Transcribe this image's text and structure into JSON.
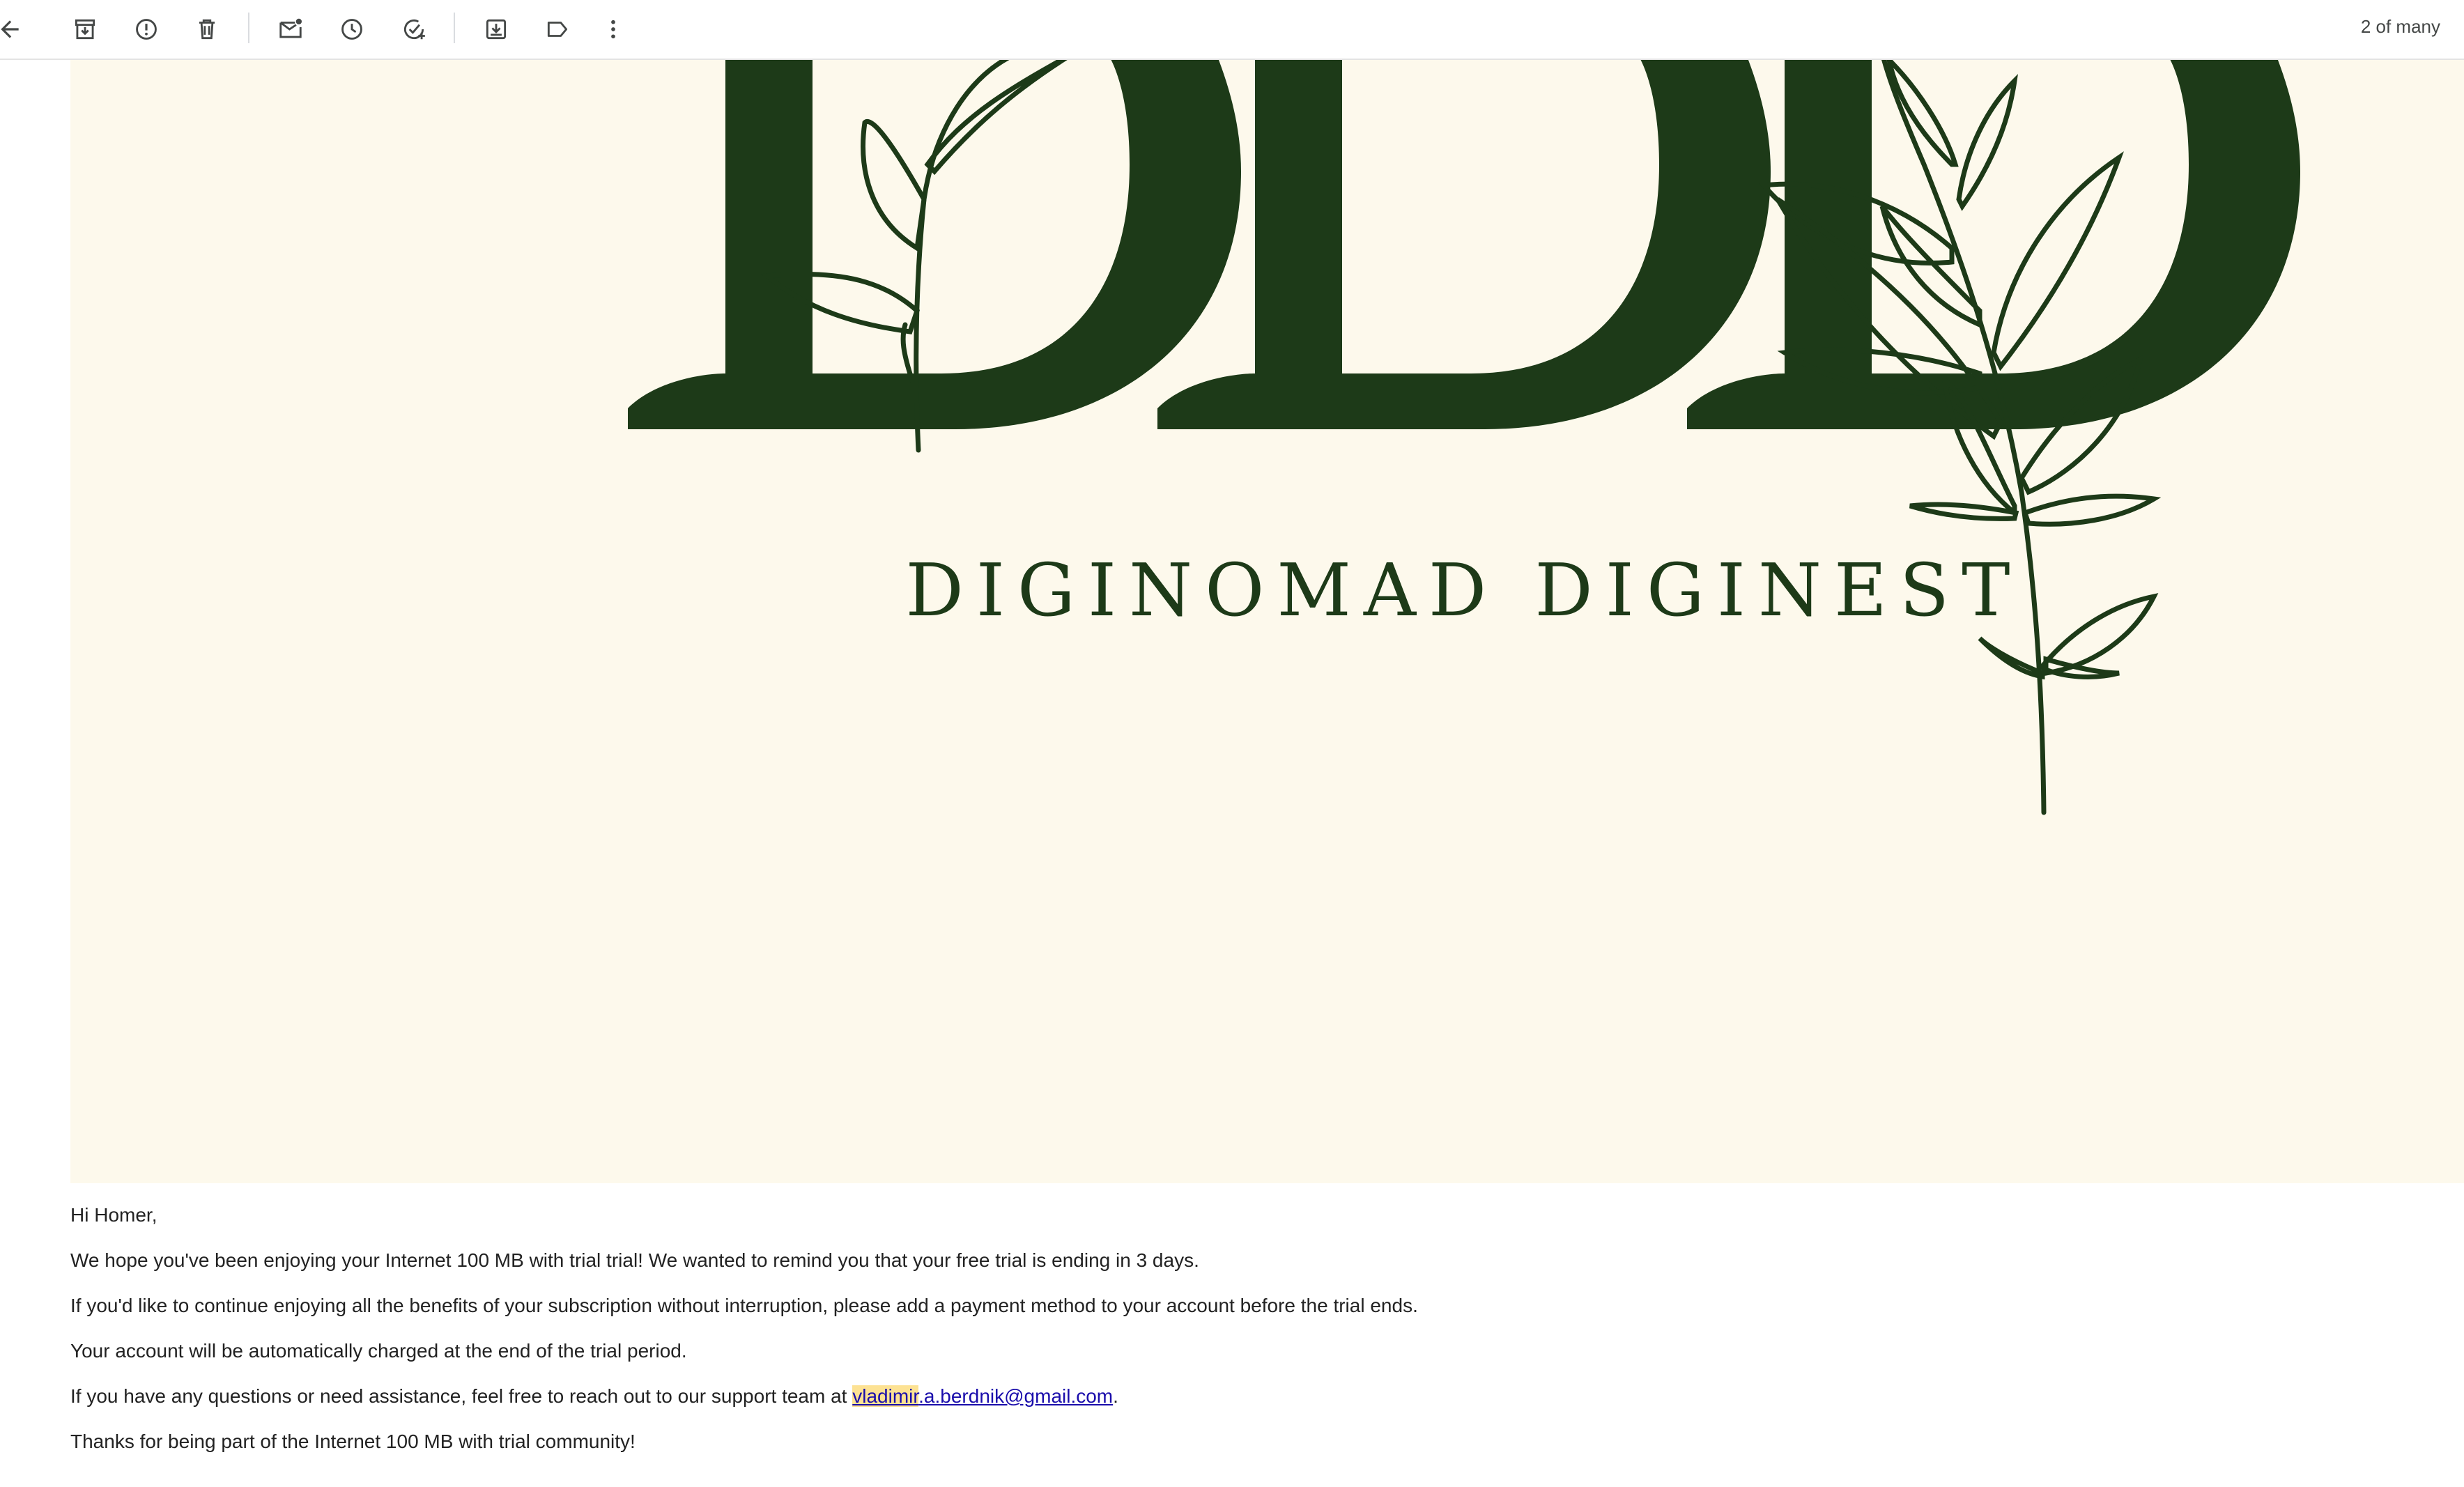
{
  "toolbar": {
    "buttons": [
      {
        "name": "back",
        "icon": "arrow-left-icon"
      },
      {
        "name": "archive",
        "icon": "archive-icon"
      },
      {
        "name": "report-spam",
        "icon": "report-spam-icon"
      },
      {
        "name": "delete",
        "icon": "trash-icon"
      },
      {
        "name": "mark-unread",
        "icon": "mark-unread-icon"
      },
      {
        "name": "snooze",
        "icon": "clock-icon"
      },
      {
        "name": "add-to-tasks",
        "icon": "add-task-icon"
      },
      {
        "name": "move-to",
        "icon": "move-to-icon"
      },
      {
        "name": "label",
        "icon": "label-icon"
      },
      {
        "name": "more",
        "icon": "more-vert-icon"
      }
    ],
    "pager": "2 of many"
  },
  "hero": {
    "logo_letters": "DD",
    "brand_name": "DIGINOMAD DIGINEST",
    "background_color": "#fdf9ec",
    "brand_color": "#1d3a18"
  },
  "email": {
    "greeting": "Hi Homer,",
    "line1": "We hope you've been enjoying your Internet 100 MB with trial trial! We wanted to remind you that your free trial is ending in 3 days.",
    "line2": "If you'd like to continue enjoying all the benefits of your subscription without interruption, please add a payment method to your account before the trial ends.",
    "line3": "Your account will be automatically charged at the end of the trial period.",
    "line4_prefix": "If you have any questions or need assistance, feel free to reach out to our support team at ",
    "line4_email_highlight": "vladimir",
    "line4_email_rest": ".a.berdnik@gmail.com",
    "line4_suffix": ".",
    "line5": "Thanks for being part of the Internet 100 MB with trial community!"
  }
}
